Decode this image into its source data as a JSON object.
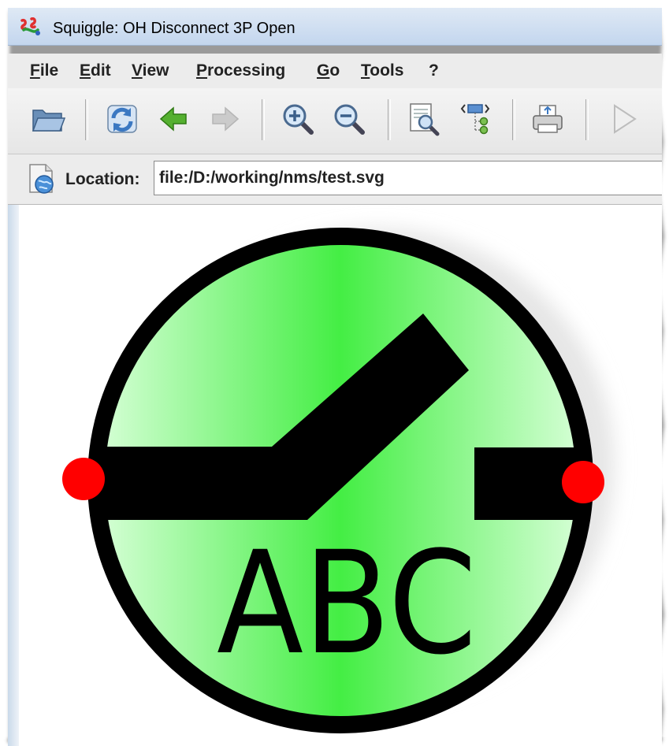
{
  "window": {
    "title": "Squiggle: OH Disconnect 3P Open"
  },
  "menu": [
    {
      "label": "File"
    },
    {
      "label": "Edit"
    },
    {
      "label": "View"
    },
    {
      "label": "Processing"
    },
    {
      "label": "Go"
    },
    {
      "label": "Tools"
    },
    {
      "label": "?"
    }
  ],
  "toolbar": {
    "buttons": [
      {
        "icon": "open-folder-icon",
        "enabled": true
      },
      {
        "icon": "reload-icon",
        "enabled": true
      },
      {
        "icon": "back-arrow-icon",
        "enabled": true
      },
      {
        "icon": "forward-arrow-icon",
        "enabled": false
      },
      {
        "icon": "zoom-in-icon",
        "enabled": true
      },
      {
        "icon": "zoom-out-icon",
        "enabled": true
      },
      {
        "icon": "view-source-icon",
        "enabled": true
      },
      {
        "icon": "dom-tree-icon",
        "enabled": true
      },
      {
        "icon": "print-icon",
        "enabled": true
      },
      {
        "icon": "play-icon",
        "enabled": false
      }
    ]
  },
  "location": {
    "label": "Location:",
    "value": "file:/D:/working/nms/test.svg"
  },
  "symbol": {
    "text": "ABC",
    "colors": {
      "fill_center": "#44ee44",
      "fill_edge": "#d8ffd8",
      "stroke": "#000000",
      "terminal": "#ff0000"
    }
  }
}
